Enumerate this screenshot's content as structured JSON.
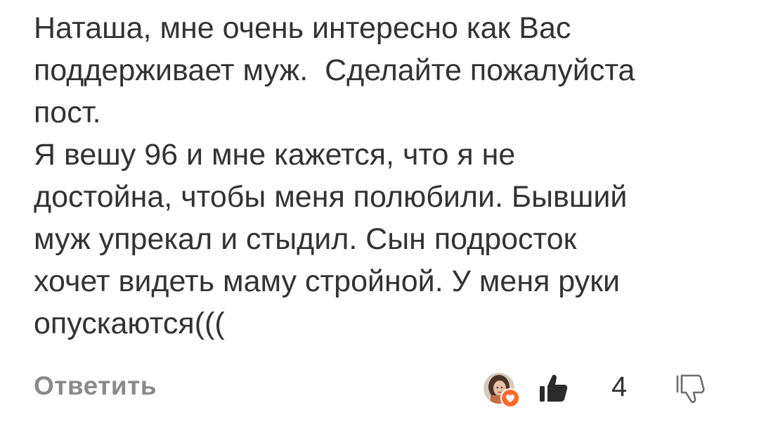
{
  "comment": {
    "lines": [
      "Наташа, мне очень интересно как Вас",
      "поддерживает муж.  Сделайте пожалуйста",
      "пост.",
      "Я вешу 96 и мне кажется, что я не",
      "достойна, чтобы меня полюбили. Бывший",
      "муж упрекал и стыдил. Сын подросток",
      "хочет видеть маму стройной. У меня руки",
      "опускаются((("
    ]
  },
  "actions": {
    "reply_label": "Ответить",
    "like_count": "4",
    "icons": {
      "avatar": "user-avatar",
      "heart_badge": "heart-icon",
      "like": "thumbs-up-icon",
      "dislike": "thumbs-down-icon"
    }
  },
  "colors": {
    "text": "#333333",
    "reply": "#8a8a8a",
    "heart_badge": "#ff6a2d",
    "like_icon": "#2b2b2b"
  }
}
